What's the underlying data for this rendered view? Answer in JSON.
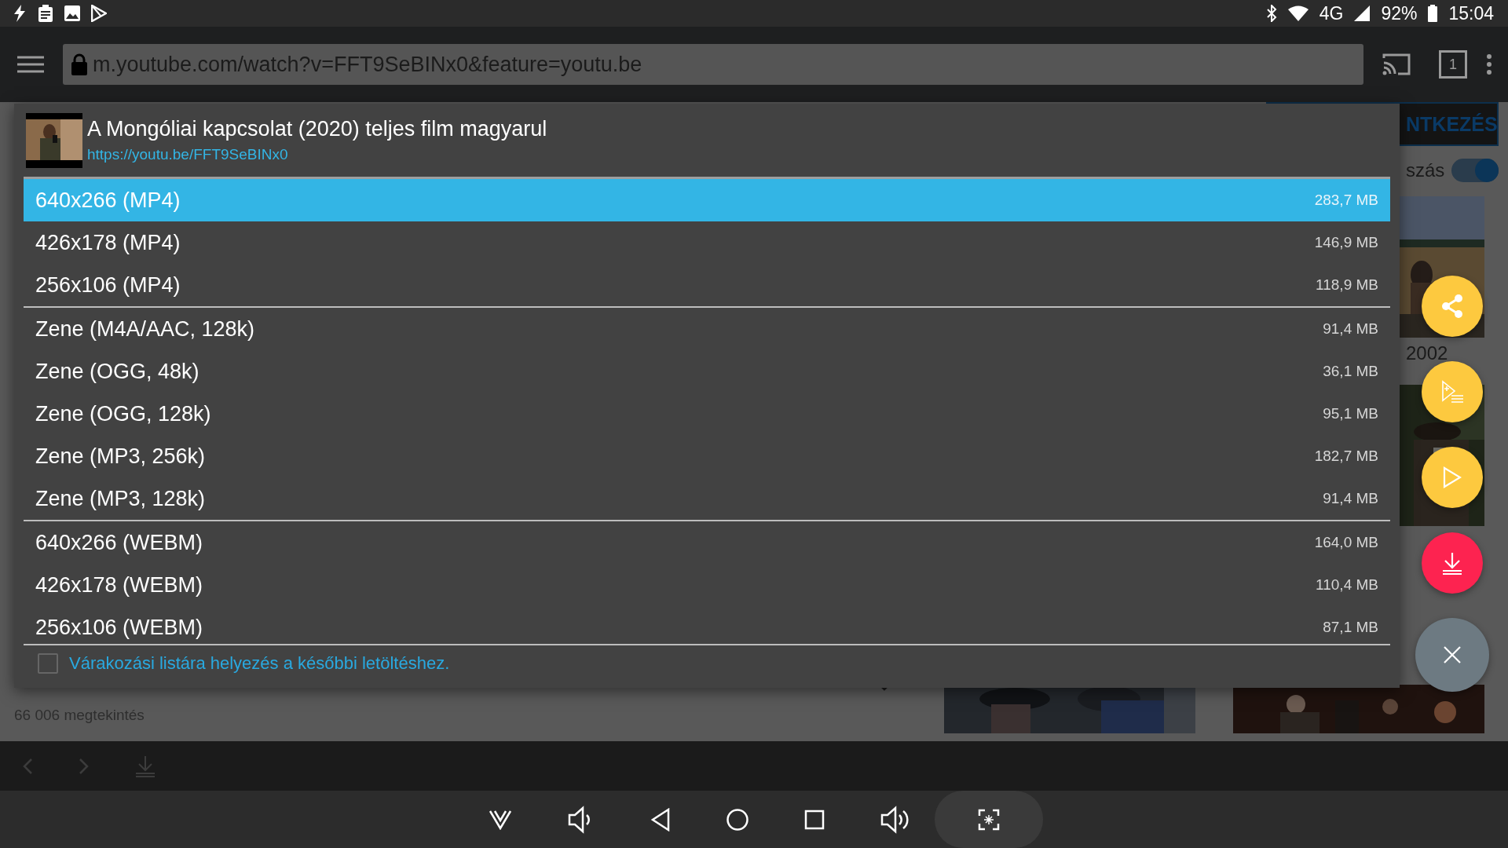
{
  "status_bar": {
    "network": "4G",
    "battery": "92%",
    "time": "15:04"
  },
  "browser": {
    "url": "m.youtube.com/watch?v=FFT9SeBINx0&feature=youtu.be",
    "tab_count": "1"
  },
  "page": {
    "login_button": "NTKEZÉS",
    "toggle_label": "szás",
    "toggle": {
      "on": true
    },
    "year": "2002",
    "views": "66 006 megtekintés"
  },
  "dialog": {
    "title": "A Mongóliai kapcsolat (2020) teljes film magyarul",
    "link": "https://youtu.be/FFT9SeBINx0",
    "groups": [
      [
        {
          "label": "640x266 (MP4)",
          "size": "283,7 MB",
          "selected": true
        },
        {
          "label": "426x178 (MP4)",
          "size": "146,9 MB",
          "selected": false
        },
        {
          "label": "256x106 (MP4)",
          "size": "118,9 MB",
          "selected": false
        }
      ],
      [
        {
          "label": "Zene (M4A/AAC, 128k)",
          "size": "91,4 MB",
          "selected": false
        },
        {
          "label": "Zene (OGG, 48k)",
          "size": "36,1 MB",
          "selected": false
        },
        {
          "label": "Zene (OGG, 128k)",
          "size": "95,1 MB",
          "selected": false
        },
        {
          "label": "Zene (MP3, 256k)",
          "size": "182,7 MB",
          "selected": false
        },
        {
          "label": "Zene (MP3, 128k)",
          "size": "91,4 MB",
          "selected": false
        }
      ],
      [
        {
          "label": "640x266 (WEBM)",
          "size": "164,0 MB",
          "selected": false
        },
        {
          "label": "426x178 (WEBM)",
          "size": "110,4 MB",
          "selected": false
        },
        {
          "label": "256x106 (WEBM)",
          "size": "87,1 MB",
          "selected": false
        }
      ]
    ],
    "queue_checkbox": {
      "label": "Várakozási listára helyezés a későbbi letöltéshez.",
      "checked": false
    }
  },
  "fabs": [
    {
      "kind": "share"
    },
    {
      "kind": "queue"
    },
    {
      "kind": "play"
    },
    {
      "kind": "download"
    },
    {
      "kind": "close"
    }
  ]
}
